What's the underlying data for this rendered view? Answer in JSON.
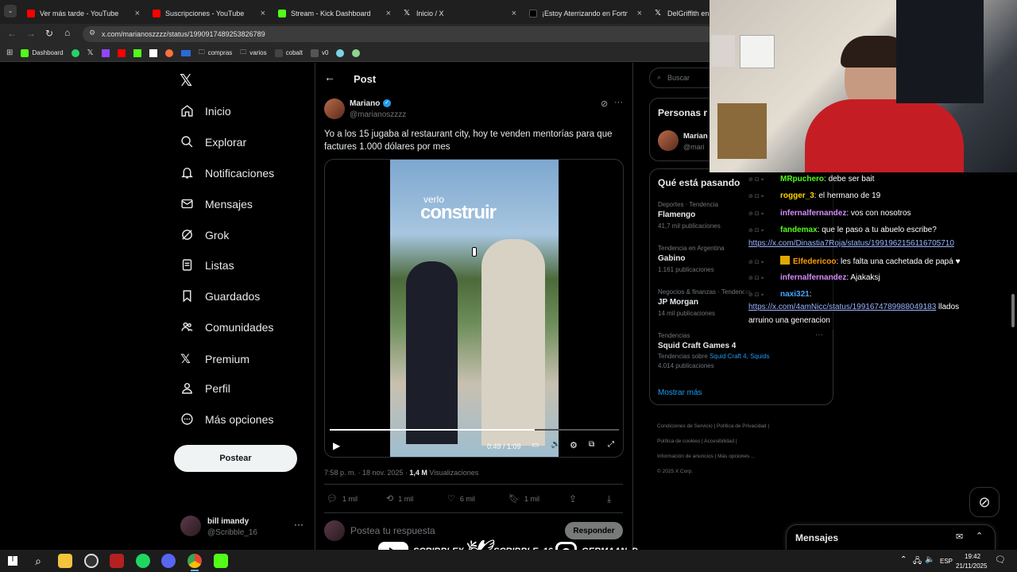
{
  "tabs": [
    {
      "label": "Ver más tarde - YouTube",
      "color": "#ff0000"
    },
    {
      "label": "Suscripciones - YouTube",
      "color": "#ff0000"
    },
    {
      "label": "Stream - Kick Dashboard",
      "color": "#53fc18"
    },
    {
      "label": "Inicio / X",
      "color": "#ffffff"
    },
    {
      "label": "¡Estoy Aterrizando en Fortnite!",
      "color": "#ffffff"
    },
    {
      "label": "DelGriffith en X",
      "color": "#ffffff"
    }
  ],
  "address": "x.com/marianoszzzz/status/1990917489253826789",
  "bookmarks": [
    "Dashboard",
    "compras",
    "varios",
    "cobalt",
    "v0"
  ],
  "nav": {
    "items": [
      "Inicio",
      "Explorar",
      "Notificaciones",
      "Mensajes",
      "Grok",
      "Listas",
      "Guardados",
      "Comunidades",
      "Premium",
      "Perfil",
      "Más opciones"
    ],
    "post_button": "Postear"
  },
  "account": {
    "name": "bill imandy",
    "handle": "@Scribble_16"
  },
  "post": {
    "header": "Post",
    "author": "Mariano",
    "handle": "@marianoszzzz",
    "text": "Yo a los 15 jugaba al restaurant city, hoy te venden mentorías para que factures 1.000 dólares por mes",
    "video_overlay_small": "verlo",
    "video_overlay_big": "construir",
    "video_time": "0:49 / 1:09",
    "video_progress": 0.71,
    "timestamp": "7:58 p. m. · 18 nov. 2025 · ",
    "views_count": "1,4 M",
    "views_label": " Visualizaciones",
    "replies": "1 mil",
    "reposts": "1 mil",
    "likes": "6 mil",
    "bookmarks": "1 mil",
    "reply_placeholder": "Postea tu respuesta",
    "reply_button": "Responder"
  },
  "sidebar": {
    "search_placeholder": "Buscar",
    "people_title": "Personas r",
    "people_name": "Marian",
    "people_handle": "@mari",
    "trends_title": "Qué está pasando",
    "trends": [
      {
        "context": "Deportes · Tendencia",
        "name": "Flamengo",
        "count": "41,7 mil publicaciones"
      },
      {
        "context": "Tendencia en Argentina",
        "name": "Gabino",
        "count": "1.161 publicaciones"
      },
      {
        "context": "Negocios & finanzas · Tendencia",
        "name": "JP Morgan",
        "count": "14 mil publicaciones"
      },
      {
        "context": "Tendencias",
        "name": "Squid Craft Games 4",
        "extra_prefix": "Tendencias sobre ",
        "extra_links": "Squid Craft 4, Squids",
        "count": "4.014 publicaciones"
      }
    ],
    "show_more": "Mostrar más",
    "footer": [
      "Condiciones de Servicio",
      "Política de Privacidad",
      "Política de cookies",
      "Accesibilidad",
      "Información de anuncios",
      "Más opciones ...",
      "© 2025 X Corp."
    ]
  },
  "messages_drawer": "Mensajes",
  "chat": [
    {
      "user": "MRpuchero",
      "color": "#53fc18",
      "msg": "debe ser bait"
    },
    {
      "user": "rogger_3",
      "color": "#ffd400",
      "msg": "el hermano de 19"
    },
    {
      "user": "infernalfernandez",
      "color": "#d78bff",
      "msg": "vos con nosotros"
    },
    {
      "user": "fandemax",
      "color": "#53fc18",
      "msg": "que le paso a tu abuelo escribe?"
    },
    {
      "link": "https://x.com/Dinastia7Roja/status/1991962156116705710"
    },
    {
      "user": "Elfedericoo",
      "color": "#ff9d00",
      "msg": "les falta una cachetada de papá ♥"
    },
    {
      "user": "infernalfernandez",
      "color": "#d78bff",
      "msg": "Ajakaksj"
    },
    {
      "user": "naxi321",
      "color": "#4aa3ff",
      "msg": ""
    },
    {
      "link": "https://x.com/4amNicc/status/1991674789988049183",
      "msg": " llados"
    },
    {
      "msg": "arruino una generacion"
    }
  ],
  "socials": [
    {
      "label": "SCRIBBLEX",
      "icon": "youtube-icon"
    },
    {
      "label": "SCRIBBLE_16",
      "icon": "twitter-icon"
    },
    {
      "label": "GERMAAN_D",
      "icon": "instagram-icon"
    }
  ],
  "taskbar": {
    "lang": "ESP",
    "time": "19:42",
    "date": "21/11/2025"
  }
}
